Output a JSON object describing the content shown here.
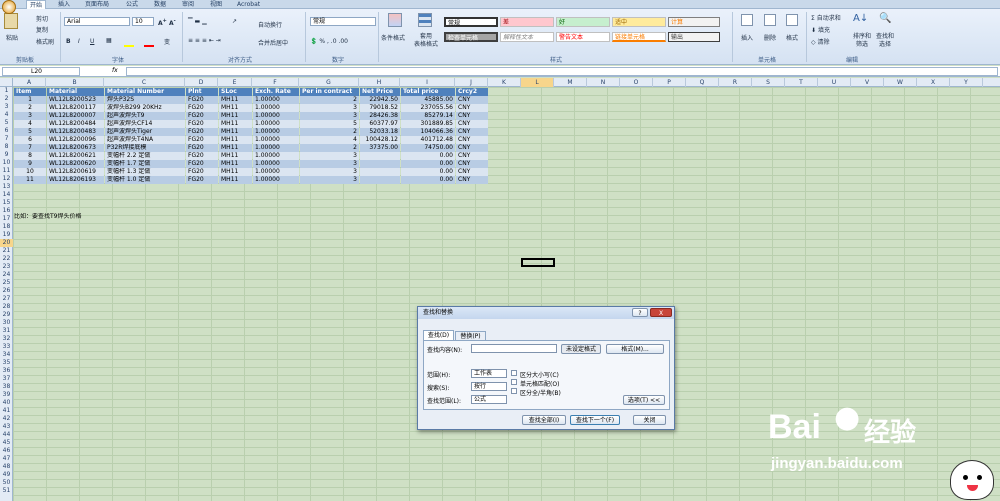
{
  "tabs": [
    "开始",
    "插入",
    "页面布局",
    "公式",
    "数据",
    "审阅",
    "视图",
    "Acrobat"
  ],
  "ribbon": {
    "clipboard": {
      "paste": "粘贴",
      "cut": "剪切",
      "copy": "复制",
      "format_painter": "格式刷",
      "label": "剪贴板"
    },
    "font": {
      "name": "Arial",
      "size": "10",
      "label": "字体"
    },
    "alignment": {
      "wrap": "自动换行",
      "merge": "合并后居中",
      "label": "对齐方式"
    },
    "number": {
      "format": "常规",
      "label": "数字"
    },
    "styles": {
      "cond": "条件格式",
      "table": "套用\n表格格式",
      "label": "样式",
      "cells": [
        {
          "text": "常规",
          "bg": "#ffffff",
          "fg": "#000000"
        },
        {
          "text": "差",
          "bg": "#ffc7ce",
          "fg": "#9c0006"
        },
        {
          "text": "好",
          "bg": "#c6efce",
          "fg": "#006100"
        },
        {
          "text": "适中",
          "bg": "#ffeb9c",
          "fg": "#9c6500"
        },
        {
          "text": "计算",
          "bg": "#f2f2f2",
          "fg": "#fa7d00"
        },
        {
          "text": "检查单元格",
          "bg": "#a5a5a5",
          "fg": "#ffffff"
        },
        {
          "text": "解释性文本",
          "bg": "#ffffff",
          "fg": "#7f7f7f"
        },
        {
          "text": "警告文本",
          "bg": "#ffffff",
          "fg": "#ff0000"
        },
        {
          "text": "链接单元格",
          "bg": "#ffffff",
          "fg": "#fa7d00"
        },
        {
          "text": "输出",
          "bg": "#f2f2f2",
          "fg": "#3f3f3f"
        }
      ]
    },
    "cells_grp": {
      "insert": "插入",
      "delete": "删除",
      "format": "格式",
      "label": "单元格"
    },
    "editing": {
      "autosum": "自动求和",
      "fill": "填充",
      "clear": "清除",
      "sort": "排序和\n筛选",
      "find": "查找和\n选择",
      "label": "编辑"
    }
  },
  "formula_bar": {
    "name_box": "L20",
    "fx": "fx",
    "content": ""
  },
  "columns": [
    "A",
    "B",
    "C",
    "D",
    "E",
    "F",
    "G",
    "H",
    "I",
    "J",
    "K",
    "L",
    "M",
    "N",
    "O",
    "P",
    "Q",
    "R",
    "S",
    "T",
    "U",
    "V",
    "W",
    "X",
    "Y"
  ],
  "rows": [
    "1",
    "2",
    "3",
    "4",
    "5",
    "6",
    "7",
    "8",
    "9",
    "10",
    "11",
    "12",
    "13",
    "14",
    "15",
    "16",
    "17",
    "18",
    "19",
    "20",
    "21",
    "22",
    "23",
    "24",
    "25",
    "26",
    "27",
    "28",
    "29",
    "30",
    "31",
    "32",
    "33",
    "34",
    "35",
    "36",
    "37",
    "38",
    "39",
    "40",
    "41",
    "42",
    "43",
    "44",
    "45",
    "46",
    "47",
    "48",
    "49",
    "50",
    "51"
  ],
  "table": {
    "headers": [
      "Item",
      "Material",
      "Material Number",
      "Plnt",
      "SLoc",
      "Exch. Rate",
      "Per in contract",
      "Net Price",
      "Total price",
      "Crcy2"
    ],
    "rows": [
      [
        "1",
        "WL12L8200523",
        "焊头P32S",
        "FG20",
        "MH11",
        "1.00000",
        "2",
        "22942.50",
        "45885.00",
        "CNY"
      ],
      [
        "2",
        "WL12L8200117",
        "波焊头B299 20KHz",
        "FG20",
        "MH11",
        "1.00000",
        "3",
        "79018.52",
        "237055.56",
        "CNY"
      ],
      [
        "3",
        "WL12L8200007",
        "超声波焊头T9",
        "FG20",
        "MH11",
        "1.00000",
        "3",
        "28426.38",
        "85279.14",
        "CNY"
      ],
      [
        "4",
        "WL12L8200484",
        "超声波焊头CF14",
        "FG20",
        "MH11",
        "1.00000",
        "5",
        "60377.97",
        "301889.85",
        "CNY"
      ],
      [
        "5",
        "WL12L8200483",
        "超声波焊头Tiger",
        "FG20",
        "MH11",
        "1.00000",
        "2",
        "52033.18",
        "104066.36",
        "CNY"
      ],
      [
        "6",
        "WL12L8200096",
        "超声波焊头T4NA",
        "FG20",
        "MH11",
        "1.00000",
        "4",
        "100428.12",
        "401712.48",
        "CNY"
      ],
      [
        "7",
        "WL12L8200673",
        "P32R焊接底模",
        "FG20",
        "MH11",
        "1.00000",
        "2",
        "37375.00",
        "74750.00",
        "CNY"
      ],
      [
        "8",
        "WL12L8200621",
        "变幅杆 2.2 定做",
        "FG20",
        "MH11",
        "1.00000",
        "3",
        "",
        "0.00",
        "CNY"
      ],
      [
        "9",
        "WL12L8200620",
        "变幅杆 1.7 定做",
        "FG20",
        "MH11",
        "1.00000",
        "3",
        "",
        "0.00",
        "CNY"
      ],
      [
        "10",
        "WL12L8200619",
        "变幅杆 1.3 定做",
        "FG20",
        "MH11",
        "1.00000",
        "3",
        "",
        "0.00",
        "CNY"
      ],
      [
        "11",
        "WL12L8206193",
        "变幅杆 1.0 定做",
        "FG20",
        "MH11",
        "1.00000",
        "3",
        "",
        "0.00",
        "CNY"
      ]
    ],
    "note": "比如：要查找T9焊头价格"
  },
  "dialog": {
    "title": "查找和替换",
    "help": "?",
    "close": "X",
    "tab_find": "查找(D)",
    "tab_replace": "替换(P)",
    "find_label": "查找内容(N):",
    "find_value": "",
    "no_format": "未设定格式",
    "format_btn": "格式(M)...",
    "scope_label": "范围(H):",
    "scope_value": "工作表",
    "search_label": "搜索(S):",
    "search_value": "按行",
    "lookin_label": "查找范围(L):",
    "lookin_value": "公式",
    "match_case": "区分大小写(C)",
    "match_cell": "单元格匹配(O)",
    "match_width": "区分全/半角(B)",
    "options_btn": "选项(T) <<",
    "find_all": "查找全部(I)",
    "find_next": "查找下一个(F)",
    "close_btn": "关闭"
  },
  "watermark": {
    "brand": "Bai",
    "brand2": "经验",
    "url": "jingyan.baidu.com"
  }
}
